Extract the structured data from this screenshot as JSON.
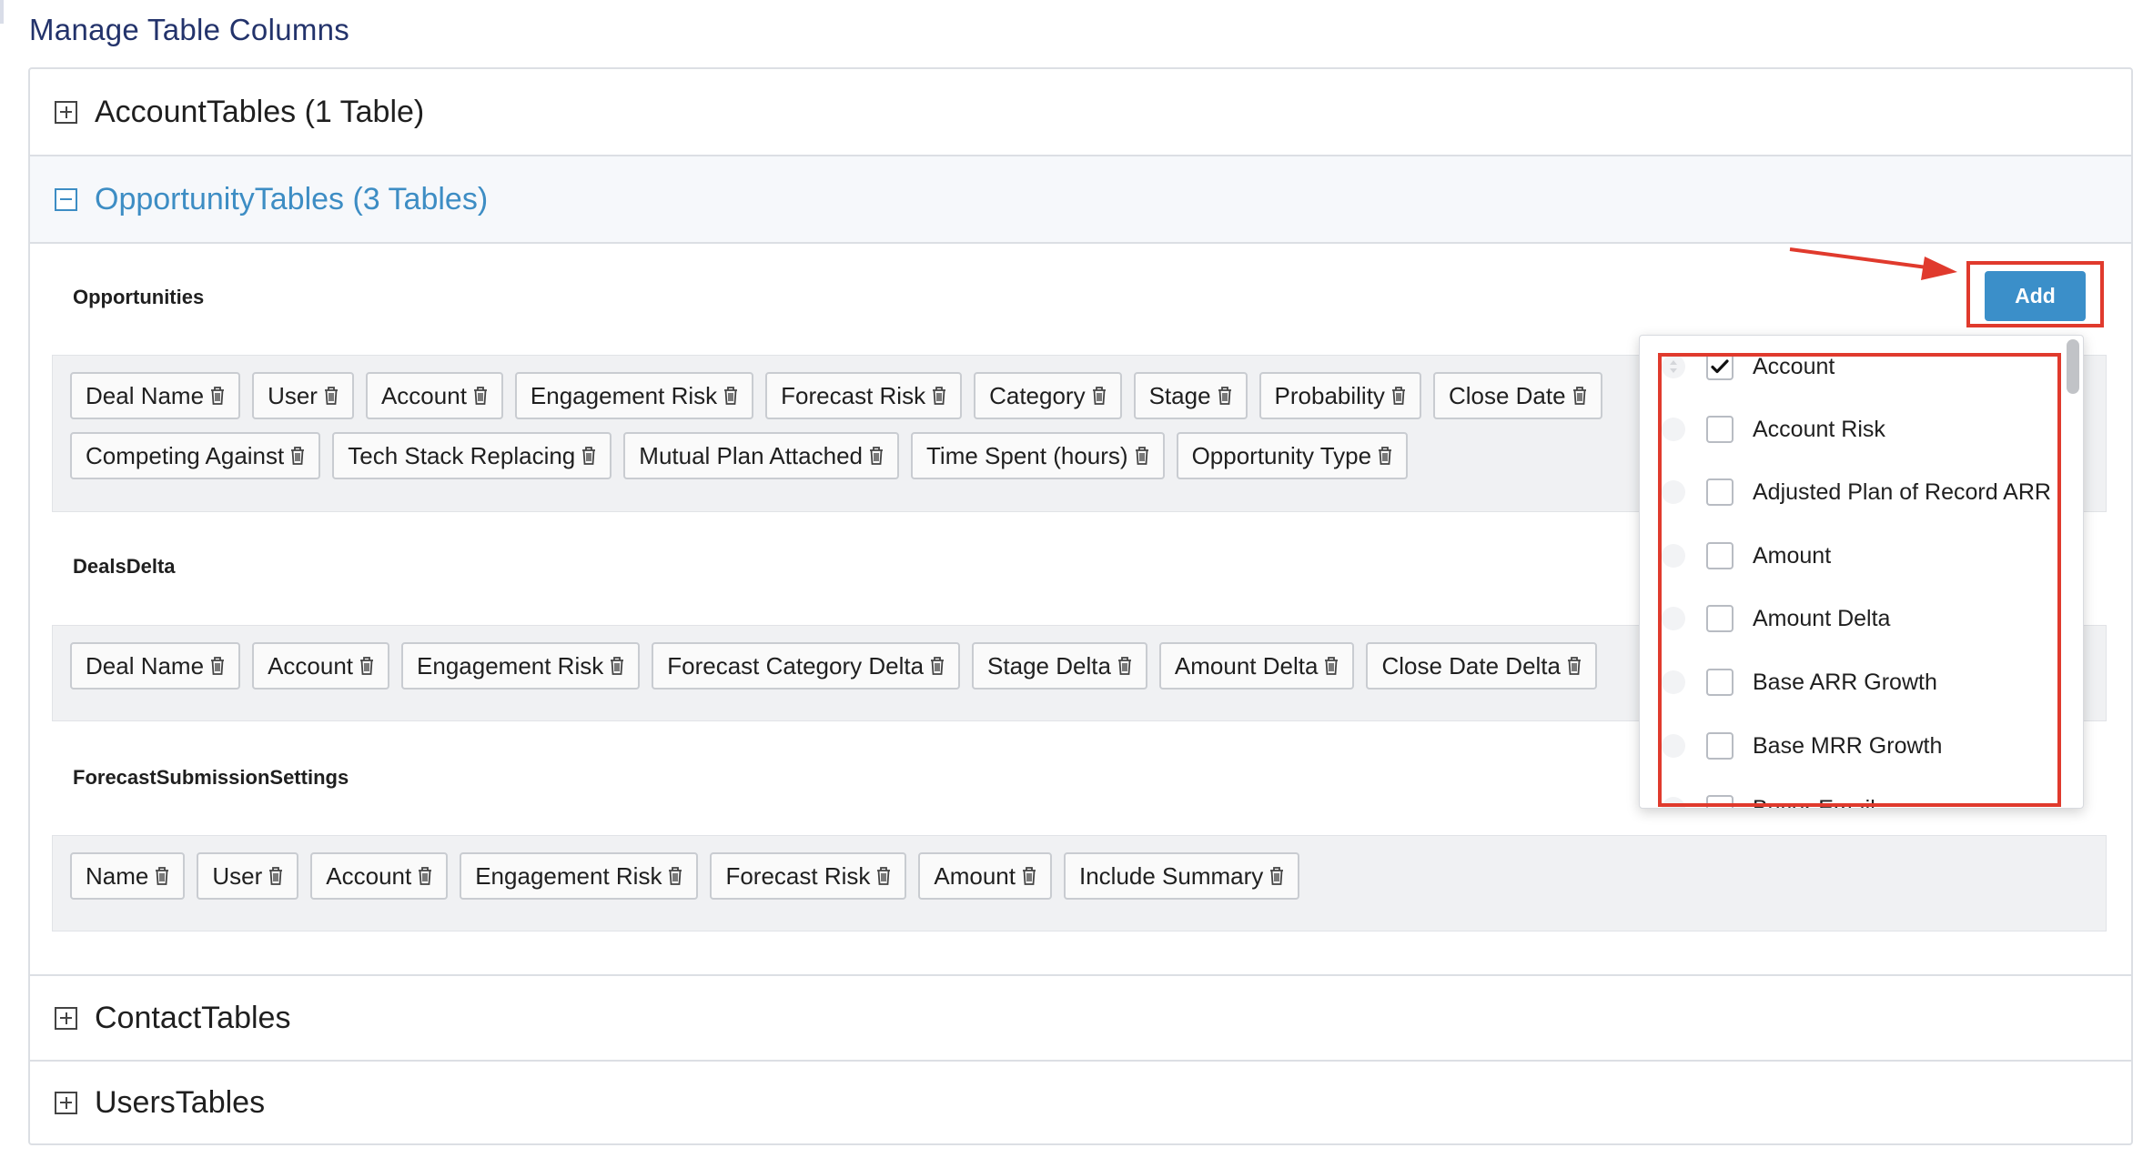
{
  "page": {
    "title": "Manage Table Columns"
  },
  "sections": [
    {
      "label": "AccountTables (1 Table)",
      "expanded": false
    },
    {
      "label": "OpportunityTables (3 Tables)",
      "expanded": true
    },
    {
      "label": "ContactTables",
      "expanded": false
    },
    {
      "label": "UsersTables",
      "expanded": false
    }
  ],
  "tables": [
    {
      "title": "Opportunities",
      "rows": [
        [
          "Deal Name",
          "User",
          "Account",
          "Engagement Risk",
          "Forecast Risk",
          "Category",
          "Stage",
          "Probability",
          "Close Date"
        ],
        [
          "Competing Against",
          "Tech Stack Replacing",
          "Mutual Plan Attached",
          "Time Spent (hours)",
          "Opportunity Type"
        ]
      ]
    },
    {
      "title": "DealsDelta",
      "rows": [
        [
          "Deal Name",
          "Account",
          "Engagement Risk",
          "Forecast Category Delta",
          "Stage Delta",
          "Amount Delta",
          "Close Date Delta"
        ]
      ]
    },
    {
      "title": "ForecastSubmissionSettings",
      "rows": [
        [
          "Name",
          "User",
          "Account",
          "Engagement Risk",
          "Forecast Risk",
          "Amount",
          "Include Summary"
        ]
      ]
    }
  ],
  "add_button": {
    "label": "Add"
  },
  "dropdown": {
    "options": [
      {
        "label": "Account",
        "checked": true
      },
      {
        "label": "Account Risk",
        "checked": false
      },
      {
        "label": "Adjusted Plan of Record ARR",
        "checked": false
      },
      {
        "label": "Amount",
        "checked": false
      },
      {
        "label": "Amount Delta",
        "checked": false
      },
      {
        "label": "Base ARR Growth",
        "checked": false
      },
      {
        "label": "Base MRR Growth",
        "checked": false
      },
      {
        "label": "Buyer Email",
        "checked": false
      }
    ]
  },
  "icons": {
    "chip_remove": "trash-icon",
    "expand": "plus-square-icon",
    "collapse": "minus-square-icon",
    "checkbox_checked": "checkmark-icon",
    "drag": "drag-handle-icon"
  },
  "colors": {
    "title": "#23336b",
    "accent_blue": "#3d8dc4",
    "add_button": "#3b8fc9",
    "annotation_red": "#e03a2d",
    "chip_border": "#c9ccd1",
    "panel_bg": "#f0f1f3"
  }
}
